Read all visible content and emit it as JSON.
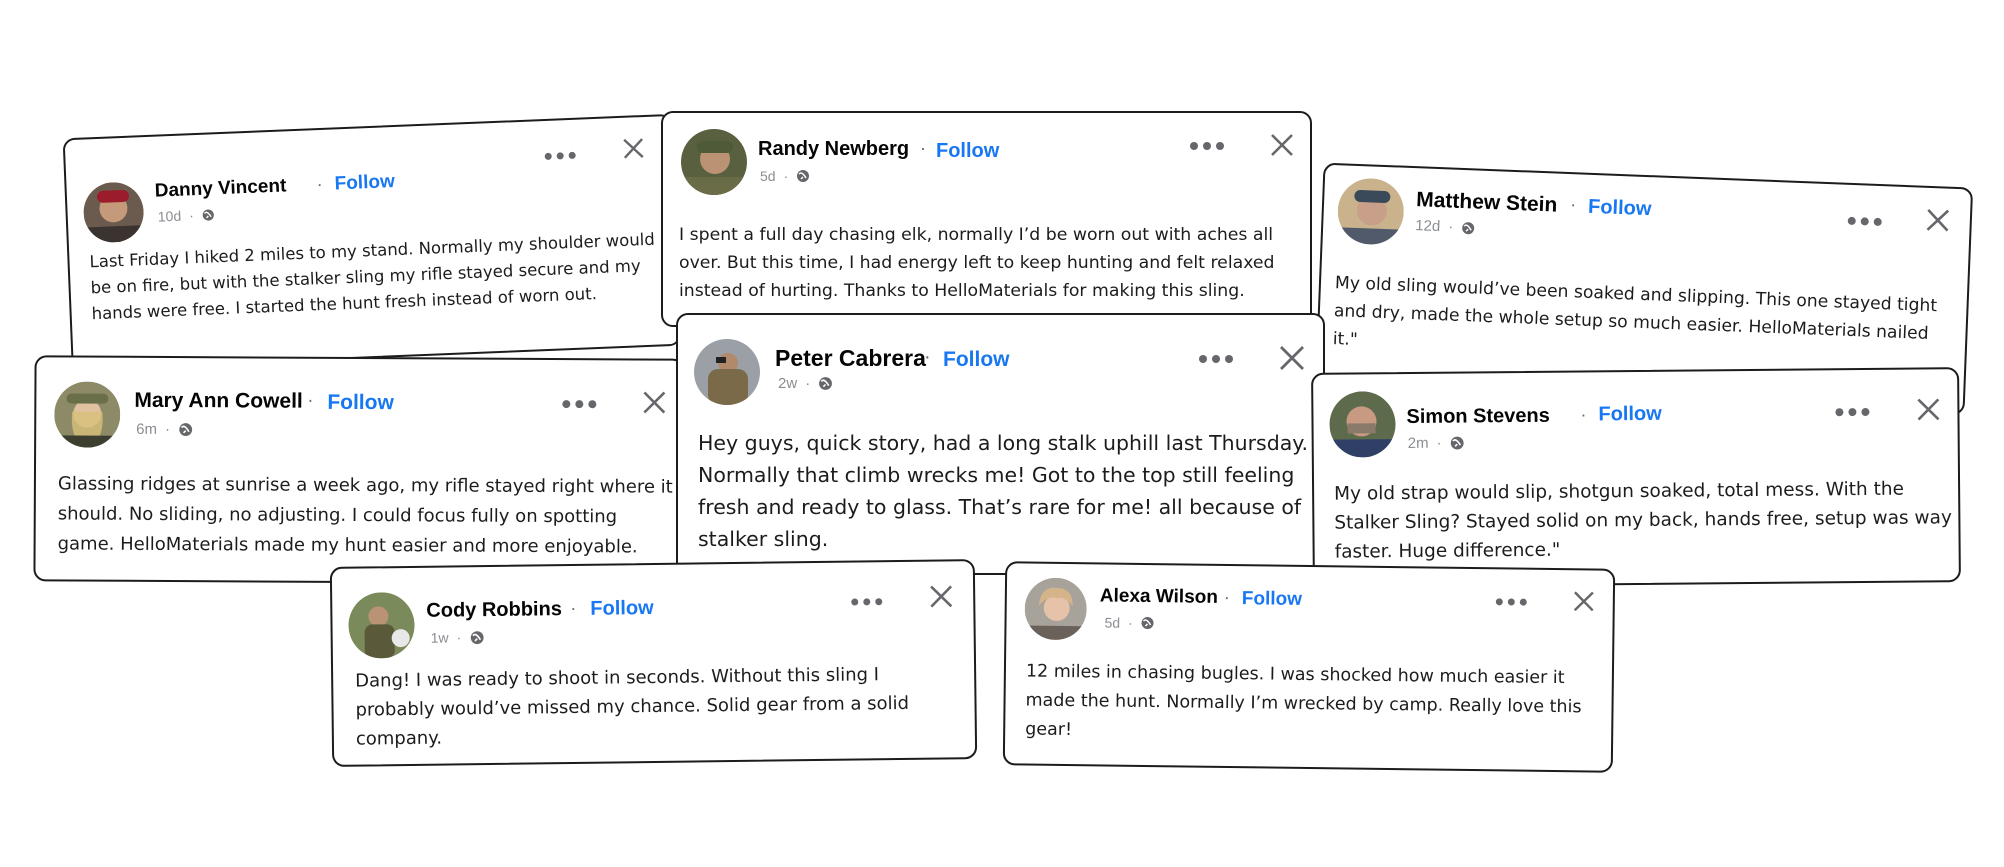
{
  "posts": [
    {
      "name": "Danny Vincent",
      "time": "10d",
      "follow": "Follow",
      "text": "Last Friday I hiked 2 miles to my stand. Normally my shoulder would be on fire, but with the stalker sling my rifle stayed secure and my hands were free. I started the hunt fresh instead of worn out."
    },
    {
      "name": "Randy Newberg",
      "time": "5d",
      "follow": "Follow",
      "text": "I spent a full day chasing elk, normally I’d be worn out with aches all over. But this time, I had energy left to keep hunting and felt relaxed instead of hurting. Thanks to HelloMaterials for making this sling."
    },
    {
      "name": "Matthew Stein",
      "time": "12d",
      "follow": "Follow",
      "text": "My old sling would’ve been soaked and slipping. This one stayed tight and dry, made the whole setup so much easier. HelloMaterials nailed it.\""
    },
    {
      "name": "Mary Ann Cowell",
      "time": "6m",
      "follow": "Follow",
      "text": "Glassing ridges at sunrise a week ago, my rifle stayed right where it should. No sliding, no adjusting. I could focus fully on spotting game. HelloMaterials made my hunt easier and more enjoyable."
    },
    {
      "name": "Peter Cabrera",
      "time": "2w",
      "follow": "Follow",
      "text": "Hey guys, quick story, had a long stalk uphill last Thursday. Normally that climb wrecks me! Got to the top still feeling fresh and ready to glass. That’s rare for me! all because of stalker sling."
    },
    {
      "name": "Simon Stevens",
      "time": "2m",
      "follow": "Follow",
      "text": "My old strap would slip, shotgun soaked, total mess. With the Stalker Sling? Stayed solid on my back, hands free, setup was way faster. Huge difference.\""
    },
    {
      "name": "Cody Robbins",
      "time": "1w",
      "follow": "Follow",
      "text": "Dang! I was ready to shoot in seconds. Without this sling  I probably would’ve missed my chance. Solid gear from a solid company."
    },
    {
      "name": "Alexa Wilson",
      "time": "5d",
      "follow": "Follow",
      "text": "12 miles in chasing bugles. I was shocked how much easier it made the hunt. Normally I’m wrecked by camp. Really love this gear!"
    }
  ],
  "icons": {
    "more": "more-options-icon",
    "close": "close-icon",
    "globe": "globe-icon"
  },
  "colors": {
    "follow": "#1877f2",
    "text": "#1c1c1c",
    "meta": "#8a8d91",
    "border": "#1c1c1c"
  }
}
